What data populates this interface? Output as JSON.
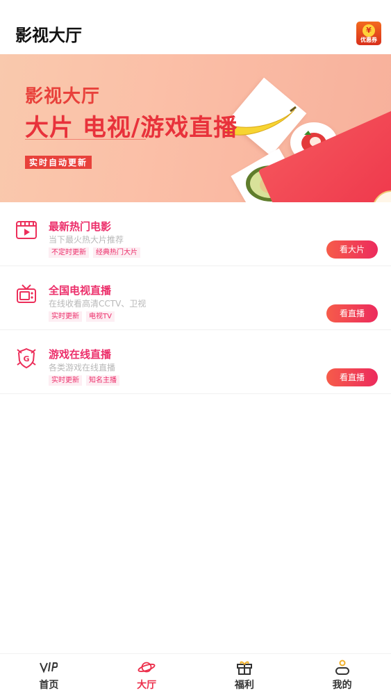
{
  "header": {
    "title": "影视大厅",
    "coupon_label": "优惠券",
    "coupon_symbol": "¥"
  },
  "banner": {
    "title": "影视大厅",
    "headline": "大片 电视/游戏直播",
    "tag": "实时自动更新"
  },
  "items": [
    {
      "icon": "film-icon",
      "title": "最新热门电影",
      "subtitle": "当下最火热大片推荐",
      "tags": [
        "不定时更新",
        "经典热门大片"
      ],
      "button": "看大片"
    },
    {
      "icon": "tv-icon",
      "title": "全国电视直播",
      "subtitle": "在线收看高清CCTV、卫视",
      "tags": [
        "实时更新",
        "电视TV"
      ],
      "button": "看直播"
    },
    {
      "icon": "game-shield-icon",
      "title": "游戏在线直播",
      "subtitle": "各类游戏在线直播",
      "tags": [
        "实时更新",
        "知名主播"
      ],
      "button": "看直播"
    }
  ],
  "nav": {
    "home": "首页",
    "hall": "大厅",
    "welfare": "福利",
    "mine": "我的",
    "active": "hall",
    "accent_color": "#ec2e4a"
  }
}
